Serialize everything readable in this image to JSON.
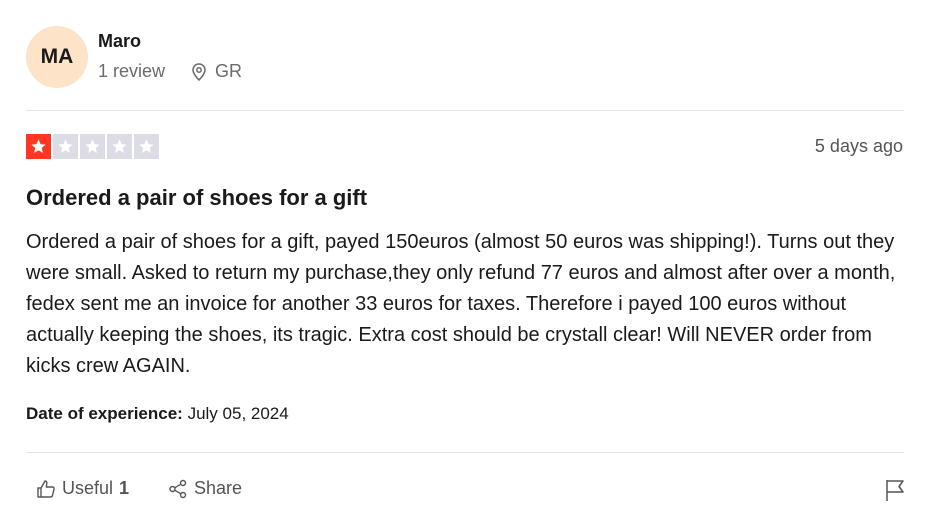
{
  "reviewer": {
    "initials": "MA",
    "name": "Maro",
    "review_count": "1 review",
    "location": "GR"
  },
  "review": {
    "rating": 1,
    "max_rating": 5,
    "date_ago": "5 days ago",
    "title": "Ordered a pair of shoes for a gift",
    "body": "Ordered a pair of shoes for a gift, payed 150euros (almost 50 euros was shipping!). Turns out they were small. Asked to return my purchase,they only refund 77 euros and almost after over a month, fedex sent me an invoice for another 33 euros for taxes. Therefore i payed 100 euros without actually keeping the shoes, its tragic. Extra cost should be crystall clear! Will NEVER order from kicks crew AGAIN.",
    "doe_label": "Date of experience:",
    "doe_value": "July 05, 2024"
  },
  "actions": {
    "useful_label": "Useful",
    "useful_count": "1",
    "share_label": "Share"
  },
  "colors": {
    "star_filled": "#ff3722",
    "star_empty": "#dcdce6",
    "avatar_bg": "#fde3c8"
  },
  "icons": {
    "location": "map-pin-icon",
    "useful": "thumbs-up-icon",
    "share": "share-icon",
    "flag": "flag-icon"
  }
}
